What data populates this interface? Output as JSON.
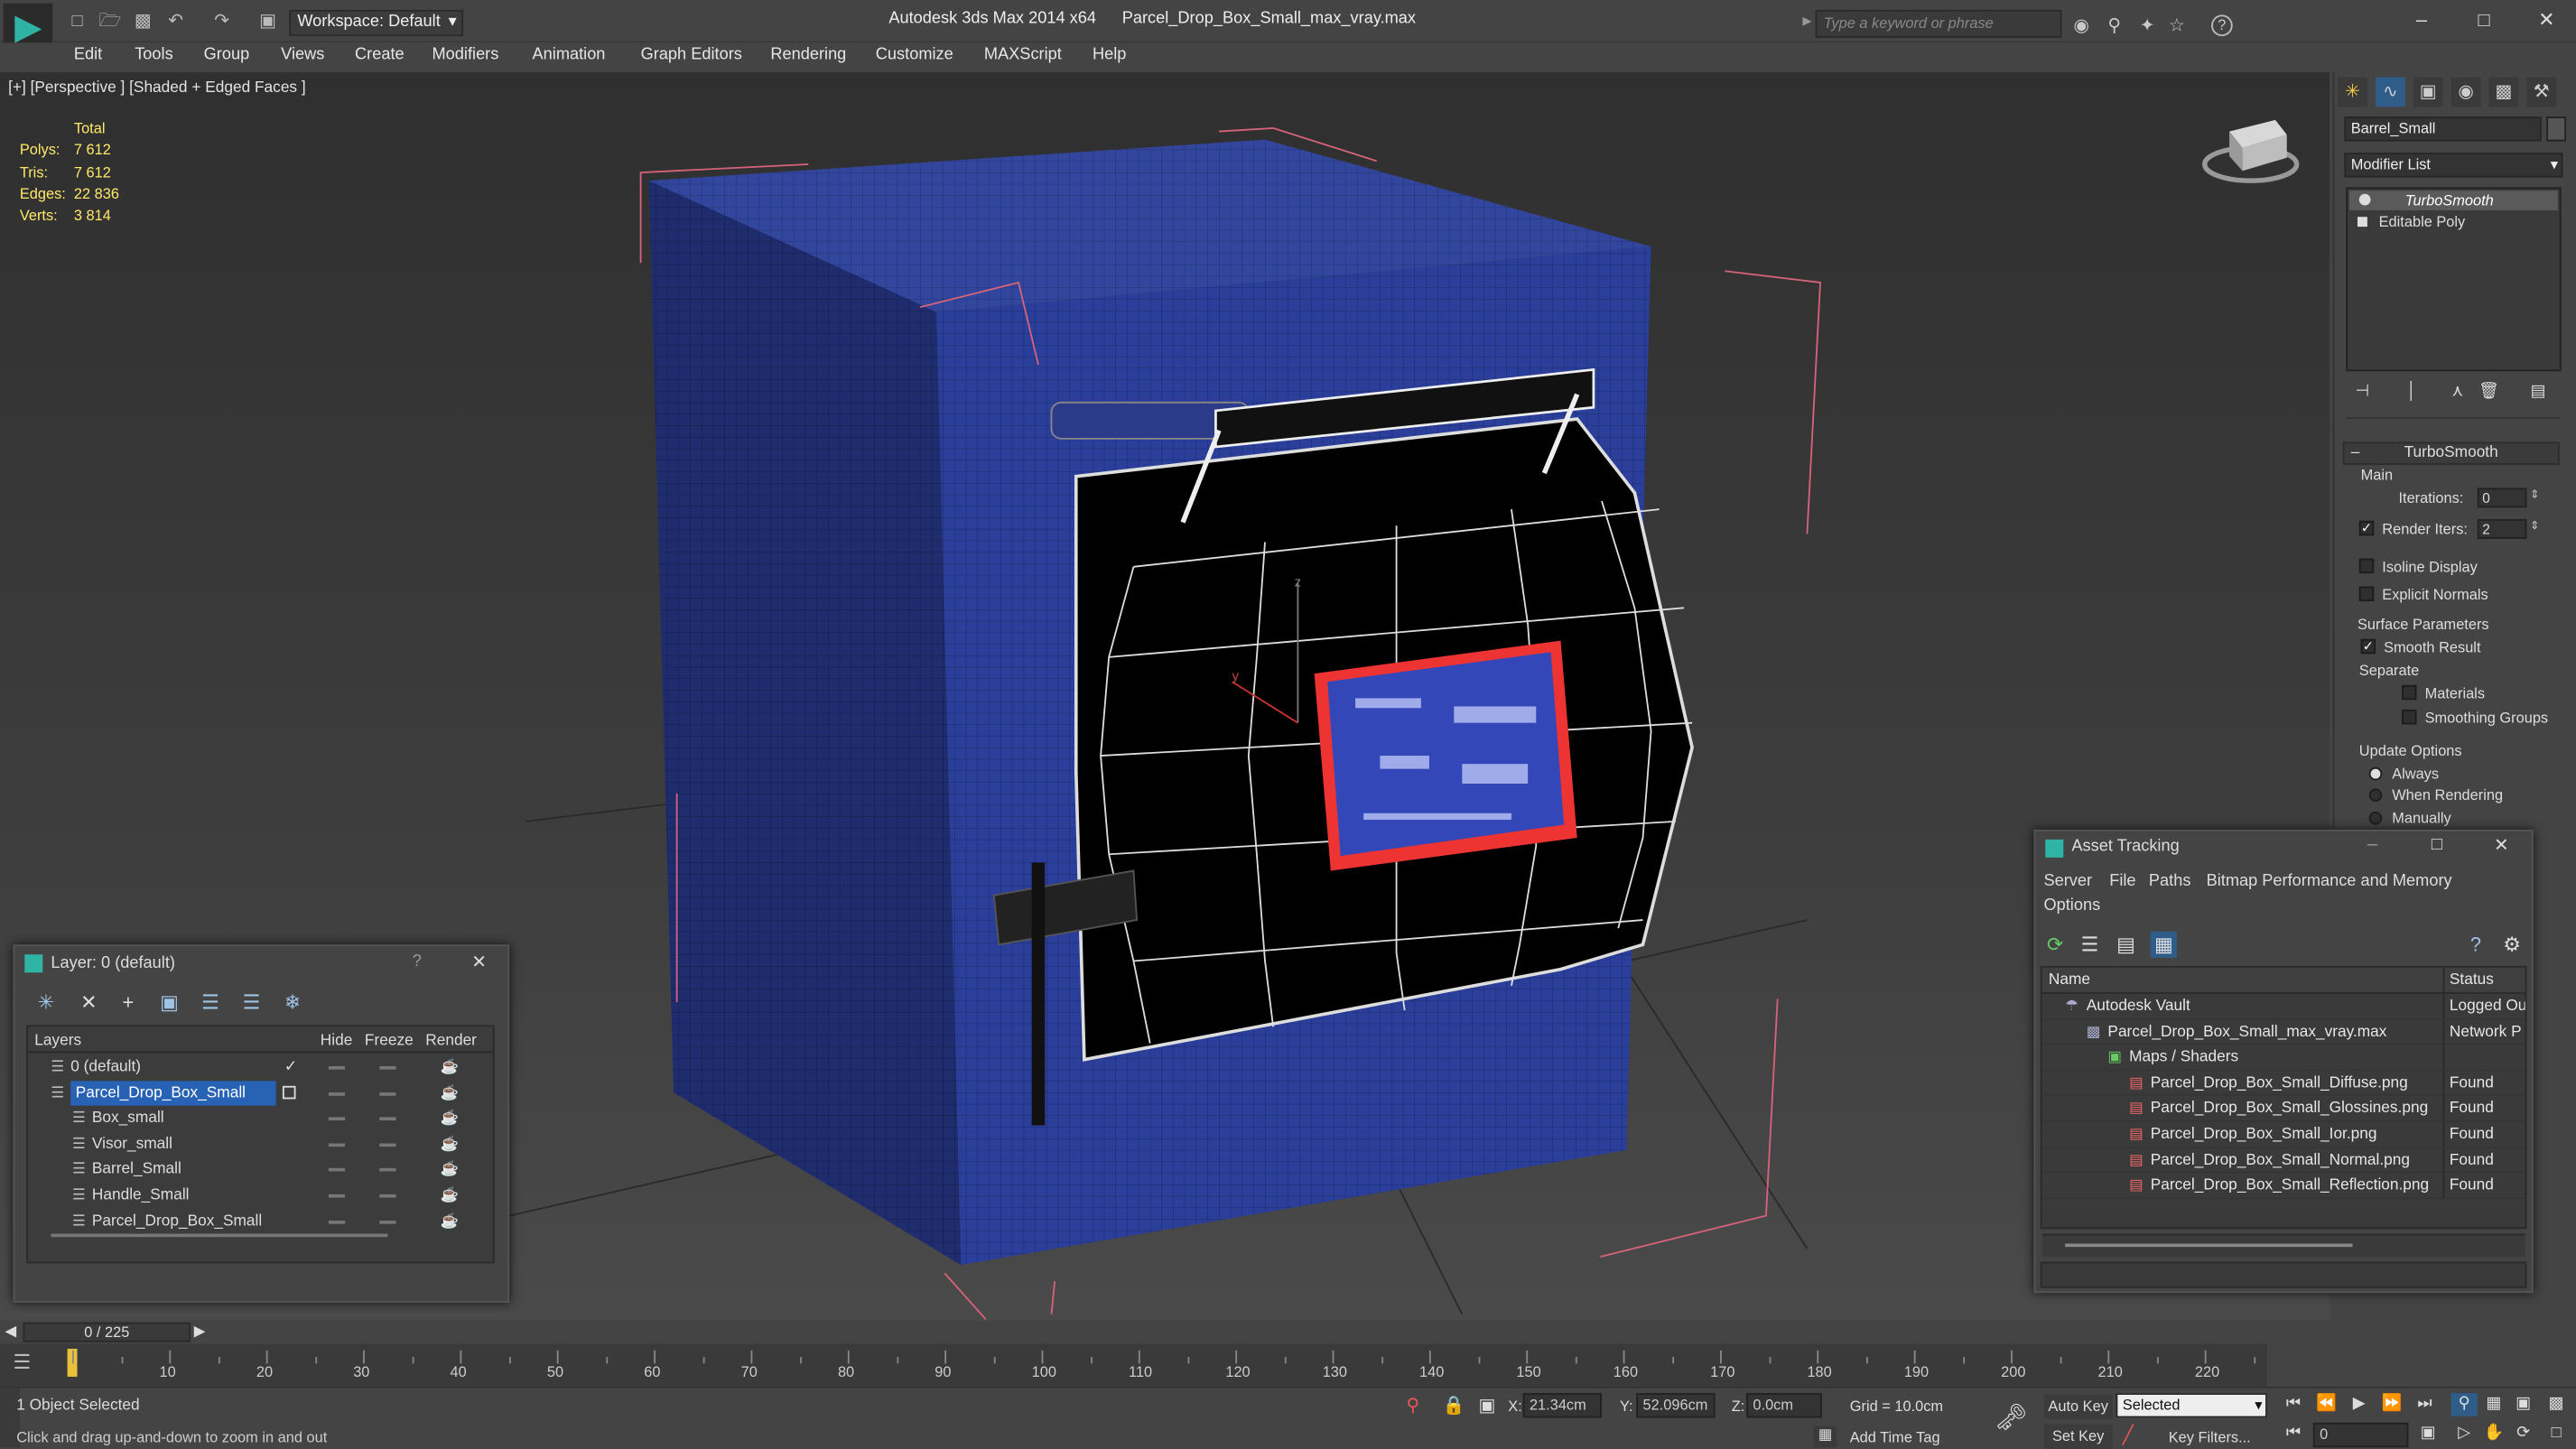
{
  "app": {
    "title": "Autodesk 3ds Max  2014 x64",
    "file": "Parcel_Drop_Box_Small_max_vray.max",
    "workspace": "Workspace: Default",
    "search_placeholder": "Type a keyword or phrase",
    "accent": "#2fb3a4"
  },
  "menu": [
    "Edit",
    "Tools",
    "Group",
    "Views",
    "Create",
    "Modifiers",
    "Animation",
    "Graph Editors",
    "Rendering",
    "Customize",
    "MAXScript",
    "Help"
  ],
  "viewport": {
    "label": "[+] [Perspective ] [Shaded + Edged Faces ]",
    "stats_header": "Total",
    "stats": [
      {
        "label": "Polys:",
        "value": "7 612"
      },
      {
        "label": "Tris:",
        "value": "7 612"
      },
      {
        "label": "Edges:",
        "value": "22 836"
      },
      {
        "label": "Verts:",
        "value": "3 814"
      }
    ],
    "box_color": "#2b3f9a",
    "axis_z": "z",
    "axis_y": "y"
  },
  "command_panel": {
    "object_name": "Barrel_Small",
    "modifier_list": "Modifier List",
    "stack": [
      "TurboSmooth",
      "Editable Poly"
    ],
    "rollout_title": "TurboSmooth",
    "main_label": "Main",
    "iterations_label": "Iterations:",
    "iterations_value": "0",
    "render_iters_label": "Render Iters:",
    "render_iters_value": "2",
    "isoline": "Isoline Display",
    "explicit_normals": "Explicit Normals",
    "surface_params": "Surface Parameters",
    "smooth_result": "Smooth Result",
    "separate": "Separate",
    "materials": "Materials",
    "smoothing_groups": "Smoothing Groups",
    "update_options": "Update Options",
    "always": "Always",
    "when_rendering": "When Rendering",
    "manually": "Manually"
  },
  "layer_window": {
    "title": "Layer: 0 (default)",
    "help": "?",
    "columns": [
      "Layers",
      "Hide",
      "Freeze",
      "Render"
    ],
    "rows": [
      {
        "name": "0 (default)",
        "indent": 1,
        "selected": false,
        "check": true
      },
      {
        "name": "Parcel_Drop_Box_Small",
        "indent": 1,
        "selected": true,
        "check": false
      },
      {
        "name": "Box_small",
        "indent": 2,
        "selected": false,
        "check": false
      },
      {
        "name": "Visor_small",
        "indent": 2,
        "selected": false,
        "check": false
      },
      {
        "name": "Barrel_Small",
        "indent": 2,
        "selected": false,
        "check": false
      },
      {
        "name": "Handle_Small",
        "indent": 2,
        "selected": false,
        "check": false
      },
      {
        "name": "Parcel_Drop_Box_Small",
        "indent": 2,
        "selected": false,
        "check": false
      }
    ]
  },
  "asset_window": {
    "title": "Asset Tracking",
    "menu": [
      "Server",
      "File",
      "Paths",
      "Bitmap Performance and Memory"
    ],
    "options": "Options",
    "columns": [
      "Name",
      "Status"
    ],
    "rows": [
      {
        "name": "Autodesk Vault",
        "status": "Logged Ou",
        "indent": 1
      },
      {
        "name": "Parcel_Drop_Box_Small_max_vray.max",
        "status": "Network P",
        "indent": 2
      },
      {
        "name": "Maps / Shaders",
        "status": "",
        "indent": 3
      },
      {
        "name": "Parcel_Drop_Box_Small_Diffuse.png",
        "status": "Found",
        "indent": 4
      },
      {
        "name": "Parcel_Drop_Box_Small_Glossines.png",
        "status": "Found",
        "indent": 4
      },
      {
        "name": "Parcel_Drop_Box_Small_Ior.png",
        "status": "Found",
        "indent": 4
      },
      {
        "name": "Parcel_Drop_Box_Small_Normal.png",
        "status": "Found",
        "indent": 4
      },
      {
        "name": "Parcel_Drop_Box_Small_Reflection.png",
        "status": "Found",
        "indent": 4
      }
    ]
  },
  "timeline": {
    "frame": "0 / 225",
    "ticks": [
      "10",
      "20",
      "30",
      "40",
      "50",
      "60",
      "70",
      "80",
      "90",
      "100",
      "110",
      "120",
      "130",
      "140",
      "150",
      "160",
      "170",
      "180",
      "190",
      "200",
      "210",
      "220"
    ]
  },
  "status": {
    "selected": "1 Object Selected",
    "hint": "Click and drag up-and-down to zoom in and out",
    "x_label": "X:",
    "x_value": "21.34cm",
    "y_label": "Y:",
    "y_value": "52.096cm",
    "z_label": "Z:",
    "z_value": "0.0cm",
    "grid": "Grid = 10.0cm",
    "auto_key": "Auto Key",
    "set_key": "Set Key",
    "selected_dropdown": "Selected",
    "key_filters": "Key Filters...",
    "add_time_tag": "Add Time Tag",
    "frame_value": "0"
  }
}
